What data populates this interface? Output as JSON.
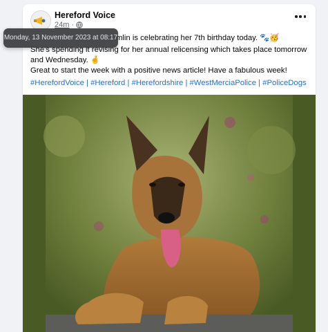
{
  "post": {
    "page_name": "Hereford Voice",
    "time": "24m",
    "separator": "·",
    "tooltip": "Monday, 13 November 2023 at 08:17",
    "line1_visible": "mlin is celebrating her 7th birthday today. 🐾🥳",
    "line2": "She's spending it revising for her annual relicensing which takes place tomorrow and Wednesday. 🤞",
    "line3": "Great to start the week with a positive news article! Have a fabulous week!",
    "hashtags": [
      "#HerefordVoice",
      "#Hereford",
      "#Herefordshire",
      "#WestMerciaPolice",
      "#PoliceDogs"
    ],
    "hashtag_separator": "|"
  },
  "icons": {
    "privacy": "globe-icon",
    "options": "more-options-icon"
  },
  "colors": {
    "link": "#216fdb",
    "photo_border": "#4a5a25"
  }
}
